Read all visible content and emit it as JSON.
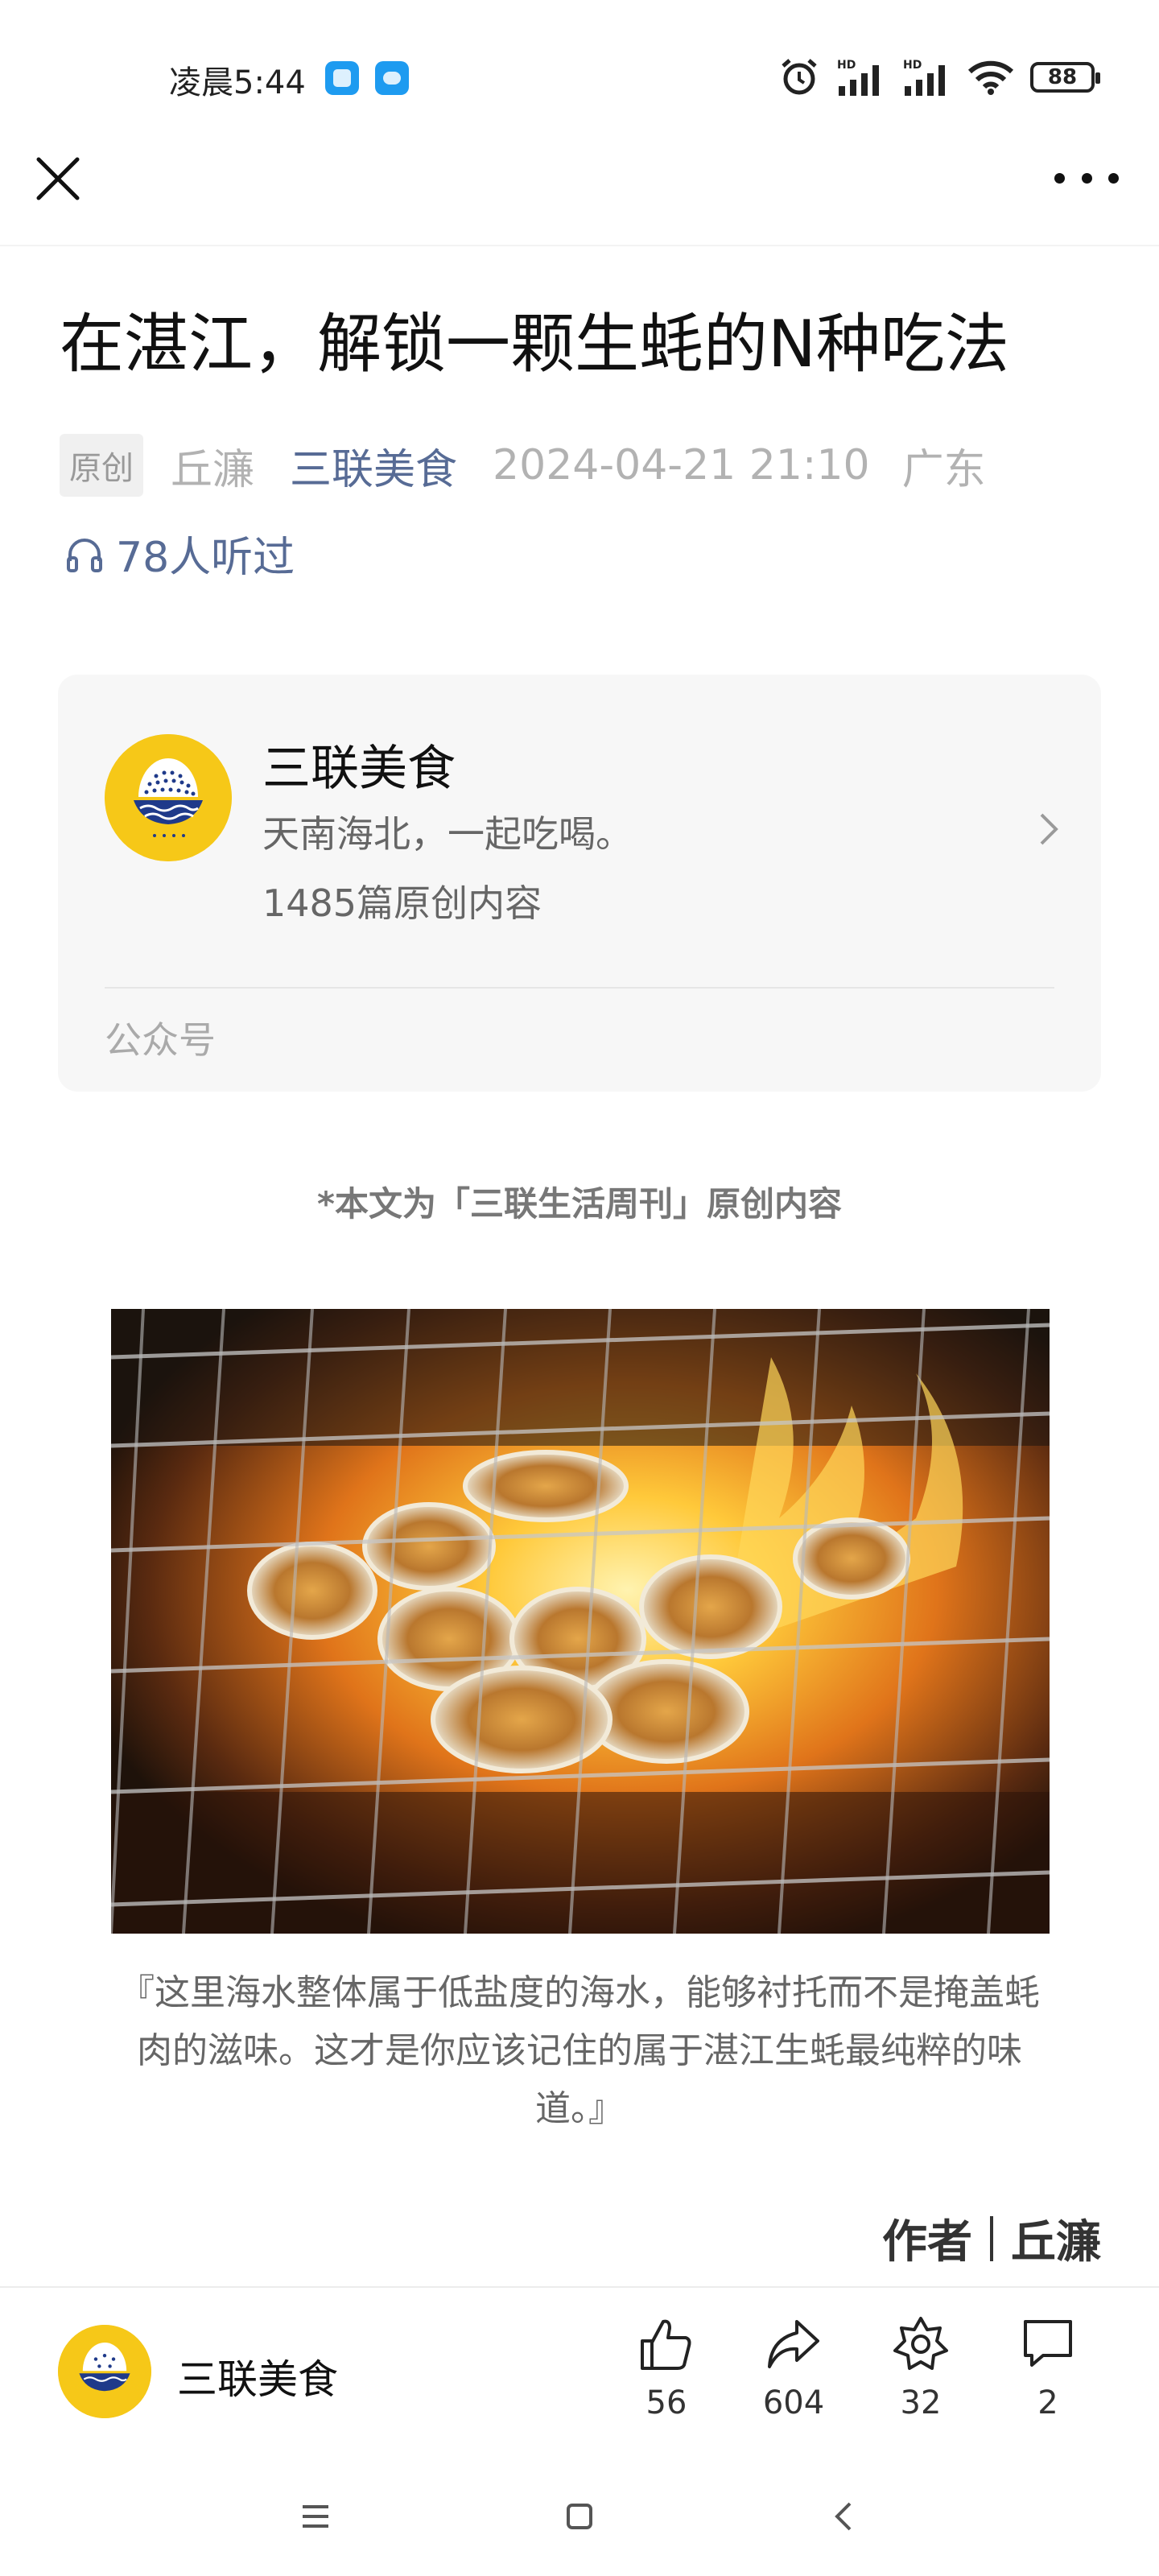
{
  "status_bar": {
    "time": "凌晨5:44",
    "battery": "88",
    "icons": [
      "app-notification-icon",
      "cloud-app-icon",
      "alarm-icon",
      "hd-signal-icon",
      "hd-signal-icon",
      "wifi-icon",
      "battery-icon"
    ]
  },
  "top_bar": {
    "close_icon": "close-icon",
    "more_icon": "more-options-icon"
  },
  "article": {
    "title": "在湛江，解锁一颗生蚝的N种吃法",
    "tag": "原创",
    "author": "丘濂",
    "account": "三联美食",
    "date": "2024-04-21 21:10",
    "location": "广东",
    "listens": "78人听过"
  },
  "account_card": {
    "name": "三联美食",
    "description": "天南海北，一起吃喝。",
    "original_count": "1485篇原创内容",
    "type": "公众号"
  },
  "body": {
    "original_note": "*本文为「三联生活周刊」原创内容",
    "photo": "grilled-oysters-photo",
    "caption": "『这里海水整体属于低盐度的海水，能够衬托而不是掩盖蚝肉的滋味。这才是你应该记住的属于湛江生蚝最纯粹的味道。』",
    "byline_label": "作者",
    "byline_name": "丘濂"
  },
  "bottom_bar": {
    "account_name": "三联美食",
    "likes": "56",
    "shares": "604",
    "favorites": "32",
    "comments": "2"
  },
  "colors": {
    "link": "#576b95",
    "muted": "#b2b2b2",
    "card_bg": "#f7f7f7",
    "brand_yellow": "#f6c818"
  }
}
